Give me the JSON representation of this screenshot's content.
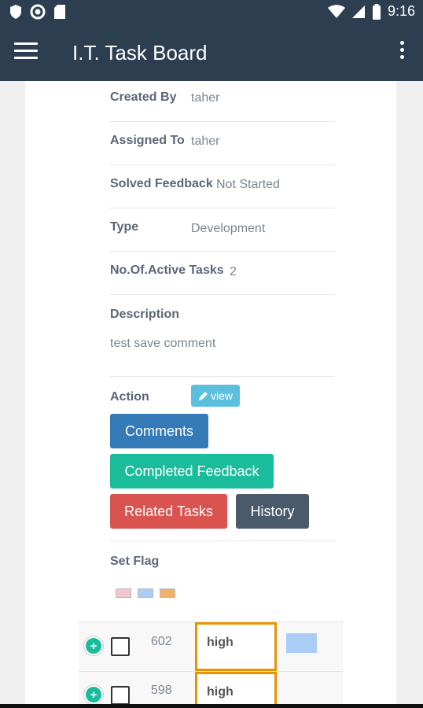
{
  "status_bar": {
    "time": "9:16",
    "left_icons": [
      "shield-icon",
      "circle-icon",
      "sd-card-icon"
    ],
    "right_icons": [
      "wifi-icon",
      "signal-icon",
      "battery-icon"
    ]
  },
  "app_bar": {
    "title": "I.T. Task Board",
    "color": "#2c3e50"
  },
  "details": {
    "created_by": {
      "label": "Created By",
      "value": "taher"
    },
    "assigned_to": {
      "label": "Assigned To",
      "value": "taher"
    },
    "solved_feedback": {
      "label": "Solved Feedback",
      "value": "Not Started"
    },
    "type": {
      "label": "Type",
      "value": "Development"
    },
    "active_tasks": {
      "label": "No.Of.Active Tasks",
      "value": "2"
    },
    "description": {
      "label": "Description",
      "value": "test save comment"
    }
  },
  "action": {
    "label": "Action",
    "view_label": "view",
    "buttons": {
      "comments": "Comments",
      "completed_feedback": "Completed Feedback",
      "related_tasks": "Related Tasks",
      "history": "History"
    }
  },
  "set_flag": {
    "label": "Set Flag",
    "colors": [
      "#f2c6cf",
      "#a9cdf5",
      "#f0b26a"
    ]
  },
  "tasks": [
    {
      "id": "602",
      "priority": "high",
      "flag_color": "#a9cdf5"
    },
    {
      "id": "598",
      "priority": "high",
      "flag_color": ""
    }
  ]
}
